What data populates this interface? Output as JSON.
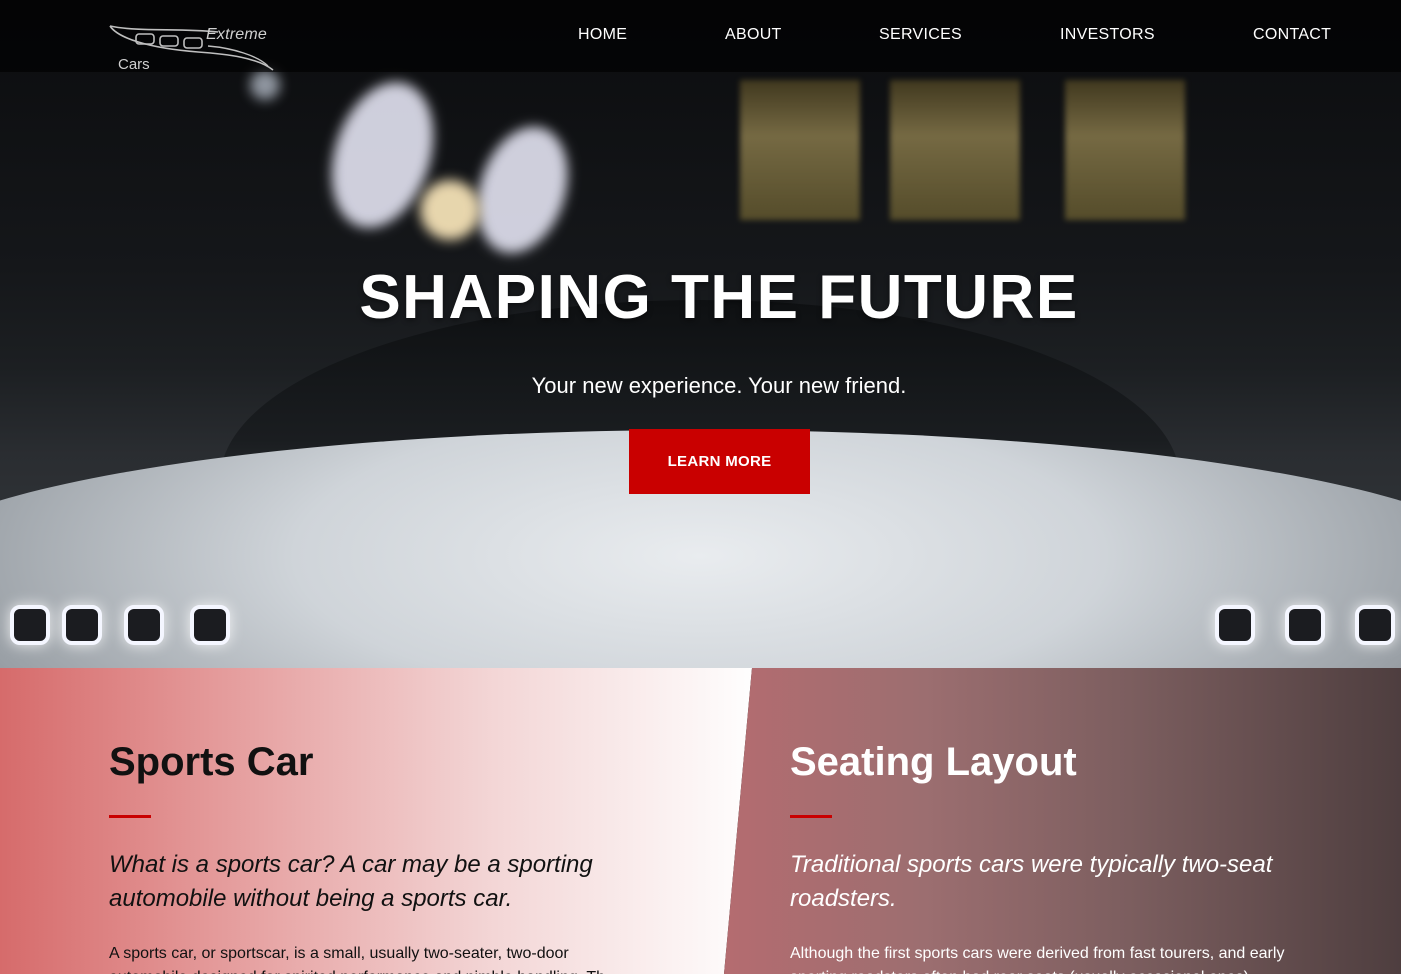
{
  "brand": {
    "top": "Extreme",
    "bottom": "Cars"
  },
  "nav": {
    "items": [
      {
        "label": "HOME"
      },
      {
        "label": "ABOUT"
      },
      {
        "label": "SERVICES"
      },
      {
        "label": "INVESTORS"
      },
      {
        "label": "CONTACT"
      }
    ]
  },
  "hero": {
    "title": "SHAPING THE FUTURE",
    "subtitle": "Your new experience. Your new friend.",
    "cta_label": "LEARN MORE"
  },
  "sections": {
    "left": {
      "title": "Sports Car",
      "lead": "What is a sports car? A car may be a sporting automobile without being a sports car.",
      "body": "A sports car, or sportscar, is a small, usually two-seater, two-door automobile designed for spirited performance and nimble handling. Th"
    },
    "right": {
      "title": "Seating Layout",
      "lead": "Traditional sports cars were typically two-seat roadsters.",
      "body": "Although the first sports cars were derived from fast tourers, and early sporting roadsters often had rear seats (usually occasional ones)"
    }
  },
  "colors": {
    "accent": "#c90000"
  }
}
